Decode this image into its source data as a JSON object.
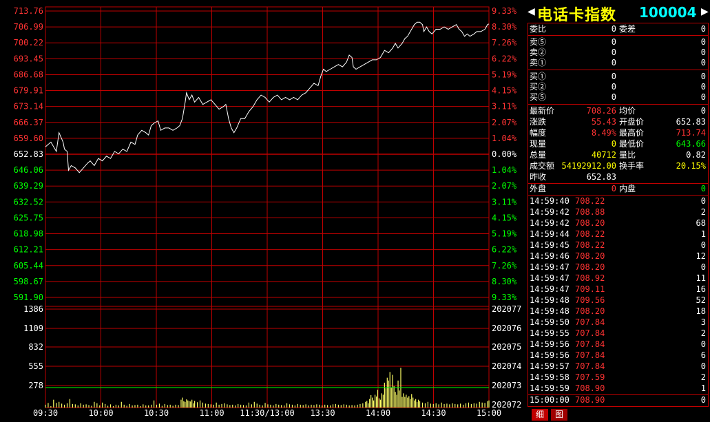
{
  "chart": {
    "price_labels_left": [
      "713.76",
      "706.99",
      "700.22",
      "693.45",
      "686.68",
      "679.91",
      "673.14",
      "666.37",
      "659.60",
      "652.83",
      "646.06",
      "639.29",
      "632.52",
      "625.75",
      "618.98",
      "612.21",
      "605.44",
      "598.67",
      "591.90"
    ],
    "pct_labels_right": [
      "9.33%",
      "8.30%",
      "7.26%",
      "6.22%",
      "5.19%",
      "4.15%",
      "3.11%",
      "2.07%",
      "1.04%",
      "0.00%",
      "1.04%",
      "2.07%",
      "3.11%",
      "4.15%",
      "5.19%",
      "6.22%",
      "7.26%",
      "8.30%",
      "9.33%"
    ],
    "volume_labels_left": [
      "1386",
      "1109",
      "832",
      "555",
      "278"
    ],
    "volume_labels_right": [
      "202077",
      "202076",
      "202075",
      "202074",
      "202073",
      "202072"
    ],
    "time_labels": [
      "09:30",
      "10:00",
      "10:30",
      "11:00",
      "11:30/13:00",
      "13:30",
      "14:00",
      "14:30",
      "15:00"
    ],
    "colors": {
      "grid": "#c00000",
      "up": "#ff3333",
      "down": "#00ff00",
      "flat": "#ffffff",
      "price_line": "#ffffff",
      "vol_bar": "#ffff66",
      "avg_line": "#00ff00"
    }
  },
  "chart_data": {
    "type": "line",
    "prev_close": 652.83,
    "ylim_price": [
      591.9,
      713.76
    ],
    "ylim_volume": [
      0,
      1386
    ],
    "price_series": [
      [
        0,
        656
      ],
      [
        4,
        658
      ],
      [
        8,
        654
      ],
      [
        10,
        662
      ],
      [
        13,
        658
      ],
      [
        14,
        655
      ],
      [
        16,
        654
      ],
      [
        17,
        646
      ],
      [
        19,
        648
      ],
      [
        22,
        647
      ],
      [
        25,
        645
      ],
      [
        28,
        647
      ],
      [
        31,
        649
      ],
      [
        33,
        650
      ],
      [
        36,
        648
      ],
      [
        39,
        651
      ],
      [
        42,
        650
      ],
      [
        45,
        652
      ],
      [
        48,
        651
      ],
      [
        51,
        654
      ],
      [
        54,
        653
      ],
      [
        57,
        655
      ],
      [
        60,
        654
      ],
      [
        63,
        658
      ],
      [
        66,
        657
      ],
      [
        68,
        661
      ],
      [
        71,
        663
      ],
      [
        74,
        662
      ],
      [
        76,
        661
      ],
      [
        78,
        665
      ],
      [
        80,
        666
      ],
      [
        83,
        667
      ],
      [
        85,
        663
      ],
      [
        88,
        664
      ],
      [
        91,
        664
      ],
      [
        94,
        663
      ],
      [
        97,
        664
      ],
      [
        99,
        665
      ],
      [
        101,
        668
      ],
      [
        103,
        675
      ],
      [
        104,
        679
      ],
      [
        106,
        676
      ],
      [
        108,
        678
      ],
      [
        110,
        675
      ],
      [
        113,
        677
      ],
      [
        116,
        674
      ],
      [
        119,
        675
      ],
      [
        122,
        676
      ],
      [
        125,
        674
      ],
      [
        128,
        672
      ],
      [
        131,
        673
      ],
      [
        133,
        674
      ],
      [
        135,
        668
      ],
      [
        137,
        664
      ],
      [
        139,
        662
      ],
      [
        141,
        664
      ],
      [
        144,
        668
      ],
      [
        147,
        668
      ],
      [
        150,
        671
      ],
      [
        153,
        673
      ],
      [
        156,
        676
      ],
      [
        159,
        678
      ],
      [
        162,
        677
      ],
      [
        165,
        675
      ],
      [
        168,
        677
      ],
      [
        171,
        678
      ],
      [
        174,
        676
      ],
      [
        177,
        677
      ],
      [
        180,
        676
      ],
      [
        183,
        677
      ],
      [
        186,
        676
      ],
      [
        189,
        678
      ],
      [
        192,
        679
      ],
      [
        195,
        681
      ],
      [
        198,
        683
      ],
      [
        201,
        682
      ],
      [
        203,
        686
      ],
      [
        205,
        689
      ],
      [
        207,
        688
      ],
      [
        210,
        689
      ],
      [
        213,
        690
      ],
      [
        216,
        691
      ],
      [
        219,
        690
      ],
      [
        222,
        692
      ],
      [
        224,
        695
      ],
      [
        226,
        694
      ],
      [
        227,
        690
      ],
      [
        229,
        689
      ],
      [
        232,
        690
      ],
      [
        235,
        691
      ],
      [
        238,
        692
      ],
      [
        241,
        693
      ],
      [
        244,
        693
      ],
      [
        247,
        694
      ],
      [
        250,
        697
      ],
      [
        253,
        696
      ],
      [
        256,
        698
      ],
      [
        258,
        700
      ],
      [
        260,
        698
      ],
      [
        263,
        700
      ],
      [
        265,
        702
      ],
      [
        267,
        703
      ],
      [
        270,
        706
      ],
      [
        272,
        708
      ],
      [
        274,
        709
      ],
      [
        276,
        709
      ],
      [
        278,
        708
      ],
      [
        279,
        705
      ],
      [
        281,
        707
      ],
      [
        283,
        705
      ],
      [
        285,
        704
      ],
      [
        288,
        706
      ],
      [
        291,
        706
      ],
      [
        294,
        707
      ],
      [
        297,
        706
      ],
      [
        300,
        707
      ],
      [
        303,
        708
      ],
      [
        305,
        706
      ],
      [
        307,
        705
      ],
      [
        309,
        703
      ],
      [
        311,
        704
      ],
      [
        313,
        703
      ],
      [
        316,
        704
      ],
      [
        318,
        705
      ],
      [
        321,
        705
      ],
      [
        324,
        706
      ],
      [
        326,
        708
      ],
      [
        327,
        708.26
      ]
    ],
    "volume_series": [
      [
        0,
        40
      ],
      [
        2,
        65
      ],
      [
        4,
        20
      ],
      [
        6,
        110
      ],
      [
        8,
        65
      ],
      [
        10,
        80
      ],
      [
        12,
        55
      ],
      [
        14,
        40
      ],
      [
        16,
        60
      ],
      [
        18,
        120
      ],
      [
        20,
        50
      ],
      [
        22,
        45
      ],
      [
        24,
        30
      ],
      [
        26,
        60
      ],
      [
        28,
        40
      ],
      [
        30,
        45
      ],
      [
        32,
        35
      ],
      [
        34,
        25
      ],
      [
        36,
        80
      ],
      [
        38,
        60
      ],
      [
        40,
        30
      ],
      [
        42,
        70
      ],
      [
        44,
        50
      ],
      [
        46,
        25
      ],
      [
        48,
        45
      ],
      [
        50,
        20
      ],
      [
        52,
        40
      ],
      [
        54,
        30
      ],
      [
        56,
        80
      ],
      [
        58,
        40
      ],
      [
        60,
        25
      ],
      [
        62,
        50
      ],
      [
        64,
        30
      ],
      [
        66,
        35
      ],
      [
        68,
        40
      ],
      [
        70,
        20
      ],
      [
        72,
        45
      ],
      [
        74,
        30
      ],
      [
        76,
        30
      ],
      [
        78,
        40
      ],
      [
        80,
        100
      ],
      [
        82,
        40
      ],
      [
        84,
        55
      ],
      [
        86,
        25
      ],
      [
        88,
        50
      ],
      [
        90,
        35
      ],
      [
        92,
        40
      ],
      [
        94,
        25
      ],
      [
        96,
        40
      ],
      [
        98,
        35
      ],
      [
        100,
        110
      ],
      [
        101,
        140
      ],
      [
        102,
        90
      ],
      [
        103,
        80
      ],
      [
        104,
        115
      ],
      [
        105,
        100
      ],
      [
        106,
        90
      ],
      [
        107,
        85
      ],
      [
        108,
        110
      ],
      [
        109,
        60
      ],
      [
        110,
        95
      ],
      [
        112,
        75
      ],
      [
        114,
        100
      ],
      [
        116,
        70
      ],
      [
        118,
        55
      ],
      [
        120,
        50
      ],
      [
        122,
        45
      ],
      [
        124,
        40
      ],
      [
        126,
        70
      ],
      [
        128,
        40
      ],
      [
        130,
        50
      ],
      [
        132,
        60
      ],
      [
        134,
        45
      ],
      [
        136,
        35
      ],
      [
        138,
        40
      ],
      [
        140,
        30
      ],
      [
        142,
        50
      ],
      [
        144,
        40
      ],
      [
        146,
        35
      ],
      [
        148,
        30
      ],
      [
        150,
        70
      ],
      [
        152,
        45
      ],
      [
        154,
        80
      ],
      [
        156,
        55
      ],
      [
        158,
        40
      ],
      [
        160,
        30
      ],
      [
        162,
        65
      ],
      [
        164,
        45
      ],
      [
        166,
        40
      ],
      [
        168,
        30
      ],
      [
        170,
        50
      ],
      [
        172,
        40
      ],
      [
        174,
        35
      ],
      [
        176,
        30
      ],
      [
        178,
        60
      ],
      [
        180,
        45
      ],
      [
        182,
        40
      ],
      [
        184,
        30
      ],
      [
        186,
        50
      ],
      [
        188,
        40
      ],
      [
        190,
        35
      ],
      [
        192,
        45
      ],
      [
        194,
        30
      ],
      [
        196,
        40
      ],
      [
        198,
        35
      ],
      [
        200,
        45
      ],
      [
        202,
        40
      ],
      [
        204,
        30
      ],
      [
        206,
        40
      ],
      [
        208,
        35
      ],
      [
        210,
        30
      ],
      [
        212,
        45
      ],
      [
        214,
        50
      ],
      [
        216,
        40
      ],
      [
        218,
        35
      ],
      [
        220,
        45
      ],
      [
        222,
        40
      ],
      [
        224,
        30
      ],
      [
        226,
        35
      ],
      [
        228,
        30
      ],
      [
        230,
        40
      ],
      [
        232,
        50
      ],
      [
        234,
        60
      ],
      [
        236,
        80
      ],
      [
        237,
        95
      ],
      [
        238,
        60
      ],
      [
        239,
        120
      ],
      [
        240,
        175
      ],
      [
        241,
        140
      ],
      [
        242,
        100
      ],
      [
        243,
        180
      ],
      [
        244,
        155
      ],
      [
        245,
        250
      ],
      [
        246,
        130
      ],
      [
        247,
        110
      ],
      [
        248,
        200
      ],
      [
        249,
        180
      ],
      [
        250,
        350
      ],
      [
        251,
        270
      ],
      [
        252,
        420
      ],
      [
        253,
        380
      ],
      [
        254,
        500
      ],
      [
        255,
        280
      ],
      [
        256,
        460
      ],
      [
        257,
        300
      ],
      [
        258,
        220
      ],
      [
        259,
        180
      ],
      [
        260,
        380
      ],
      [
        261,
        240
      ],
      [
        262,
        560
      ],
      [
        263,
        150
      ],
      [
        264,
        200
      ],
      [
        265,
        150
      ],
      [
        266,
        180
      ],
      [
        267,
        140
      ],
      [
        268,
        160
      ],
      [
        269,
        120
      ],
      [
        270,
        190
      ],
      [
        271,
        140
      ],
      [
        272,
        100
      ],
      [
        273,
        120
      ],
      [
        274,
        80
      ],
      [
        275,
        110
      ],
      [
        276,
        90
      ],
      [
        278,
        70
      ],
      [
        280,
        60
      ],
      [
        282,
        80
      ],
      [
        284,
        55
      ],
      [
        286,
        50
      ],
      [
        288,
        60
      ],
      [
        290,
        45
      ],
      [
        292,
        70
      ],
      [
        294,
        50
      ],
      [
        296,
        55
      ],
      [
        298,
        45
      ],
      [
        300,
        60
      ],
      [
        302,
        50
      ],
      [
        304,
        45
      ],
      [
        306,
        55
      ],
      [
        308,
        40
      ],
      [
        310,
        60
      ],
      [
        312,
        70
      ],
      [
        314,
        50
      ],
      [
        316,
        60
      ],
      [
        318,
        55
      ],
      [
        320,
        80
      ],
      [
        322,
        70
      ],
      [
        324,
        65
      ],
      [
        326,
        90
      ],
      [
        327,
        100
      ]
    ]
  },
  "panel": {
    "title_name": "电话卡指数",
    "title_code": "100004",
    "arrow_left": "◀",
    "arrow_right": "▶",
    "committee": {
      "wei_bi_label": "委比",
      "wei_bi_value": "0",
      "wei_cha_label": "委差",
      "wei_cha_value": "0"
    },
    "sell": [
      {
        "label": "卖⑤",
        "price": "0",
        "vol": "0"
      },
      {
        "label": "卖②",
        "price": "0",
        "vol": "0"
      },
      {
        "label": "卖①",
        "price": "0",
        "vol": "0"
      }
    ],
    "buy": [
      {
        "label": "买①",
        "price": "0",
        "vol": "0"
      },
      {
        "label": "买②",
        "price": "0",
        "vol": "0"
      },
      {
        "label": "买⑤",
        "price": "0",
        "vol": "0"
      }
    ],
    "quote": {
      "latest_label": "最新价",
      "latest": "708.26",
      "avg_label": "均价",
      "avg": "0",
      "change_label": "涨跌",
      "change": "55.43",
      "open_label": "开盘价",
      "open": "652.83",
      "amp_label": "幅度",
      "amp": "8.49%",
      "high_label": "最高价",
      "high": "713.74",
      "cur_vol_label": "现量",
      "cur_vol": "0",
      "low_label": "最低价",
      "low": "643.66",
      "total_vol_label": "总量",
      "total_vol": "40712",
      "vol_ratio_label": "量比",
      "vol_ratio": "0.82",
      "turnover_label": "成交额",
      "turnover": "54192912.00",
      "turnover_rate_label": "换手率",
      "turnover_rate": "20.15%",
      "prev_close_label": "昨收",
      "prev_close": "652.83"
    },
    "outer_inner": {
      "outer_label": "外盘",
      "outer": "0",
      "inner_label": "内盘",
      "inner": "0"
    },
    "ticks": [
      {
        "time": "14:59:40",
        "price": "708.22",
        "vol": "0"
      },
      {
        "time": "14:59:42",
        "price": "708.88",
        "vol": "2"
      },
      {
        "time": "14:59:42",
        "price": "708.20",
        "vol": "68"
      },
      {
        "time": "14:59:44",
        "price": "708.22",
        "vol": "1"
      },
      {
        "time": "14:59:45",
        "price": "708.22",
        "vol": "0"
      },
      {
        "time": "14:59:46",
        "price": "708.20",
        "vol": "12"
      },
      {
        "time": "14:59:47",
        "price": "708.20",
        "vol": "0"
      },
      {
        "time": "14:59:47",
        "price": "708.92",
        "vol": "11"
      },
      {
        "time": "14:59:47",
        "price": "709.11",
        "vol": "16"
      },
      {
        "time": "14:59:48",
        "price": "709.56",
        "vol": "52"
      },
      {
        "time": "14:59:48",
        "price": "708.20",
        "vol": "18"
      },
      {
        "time": "14:59:50",
        "price": "707.84",
        "vol": "3"
      },
      {
        "time": "14:59:55",
        "price": "707.84",
        "vol": "2"
      },
      {
        "time": "14:59:56",
        "price": "707.84",
        "vol": "0"
      },
      {
        "time": "14:59:56",
        "price": "707.84",
        "vol": "6"
      },
      {
        "time": "14:59:57",
        "price": "707.84",
        "vol": "0"
      },
      {
        "time": "14:59:58",
        "price": "707.59",
        "vol": "2"
      },
      {
        "time": "14:59:59",
        "price": "708.90",
        "vol": "1"
      },
      {
        "time": "15:00:00",
        "price": "708.90",
        "vol": "0"
      }
    ],
    "tabs": [
      {
        "label": "细"
      },
      {
        "label": "图"
      }
    ]
  }
}
